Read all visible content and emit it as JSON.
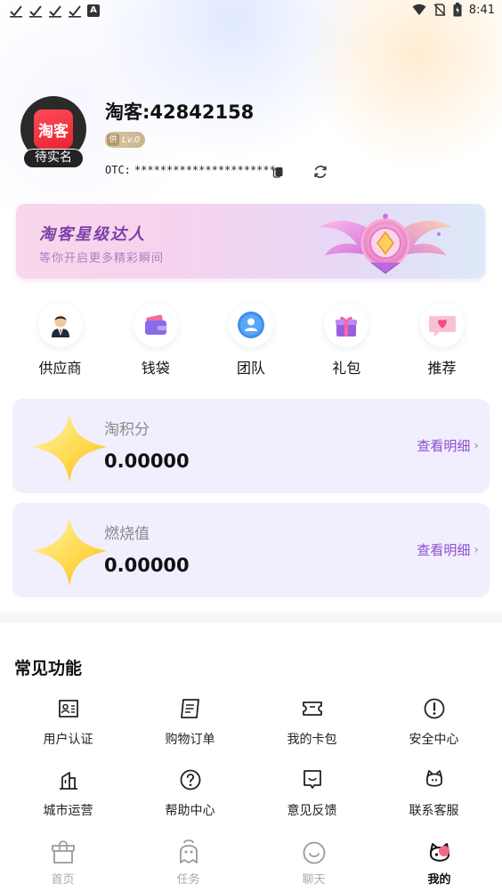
{
  "status_bar": {
    "time": "8:41",
    "a_label": "A"
  },
  "profile": {
    "avatar_text": "淘客",
    "verify_badge": "待实名",
    "username": "淘客:42842158",
    "level": "Lv.0",
    "level_icon_text": "供",
    "otc_label": "OTC:",
    "otc_value": "**********************…"
  },
  "banner": {
    "title": "淘客星级达人",
    "subtitle": "等你开启更多精彩瞬间"
  },
  "quick_nav": [
    {
      "label": "供应商",
      "icon": "supplier-icon"
    },
    {
      "label": "钱袋",
      "icon": "wallet-icon"
    },
    {
      "label": "团队",
      "icon": "team-icon"
    },
    {
      "label": "礼包",
      "icon": "gift-icon"
    },
    {
      "label": "推荐",
      "icon": "recommend-icon"
    }
  ],
  "score_cards": [
    {
      "title": "淘积分",
      "value": "0.00000",
      "link": "查看明细"
    },
    {
      "title": "燃烧值",
      "value": "0.00000",
      "link": "查看明细"
    }
  ],
  "common_functions": {
    "title": "常见功能",
    "items": [
      {
        "label": "用户认证",
        "icon": "id-card-icon"
      },
      {
        "label": "购物订单",
        "icon": "order-icon"
      },
      {
        "label": "我的卡包",
        "icon": "ticket-icon"
      },
      {
        "label": "安全中心",
        "icon": "alert-icon"
      },
      {
        "label": "城市运营",
        "icon": "city-icon"
      },
      {
        "label": "帮助中心",
        "icon": "help-icon"
      },
      {
        "label": "意见反馈",
        "icon": "feedback-icon"
      },
      {
        "label": "联系客服",
        "icon": "service-icon"
      }
    ]
  },
  "tabs": [
    {
      "label": "首页",
      "icon": "shop-icon",
      "active": false
    },
    {
      "label": "任务",
      "icon": "task-icon",
      "active": false
    },
    {
      "label": "聊天",
      "icon": "chat-icon",
      "active": false
    },
    {
      "label": "我的",
      "icon": "profile-icon",
      "active": true
    }
  ],
  "colors": {
    "accent": "#8a4fcf",
    "banner_title": "#7f3ea8",
    "card_bg": "#f1eefd"
  }
}
